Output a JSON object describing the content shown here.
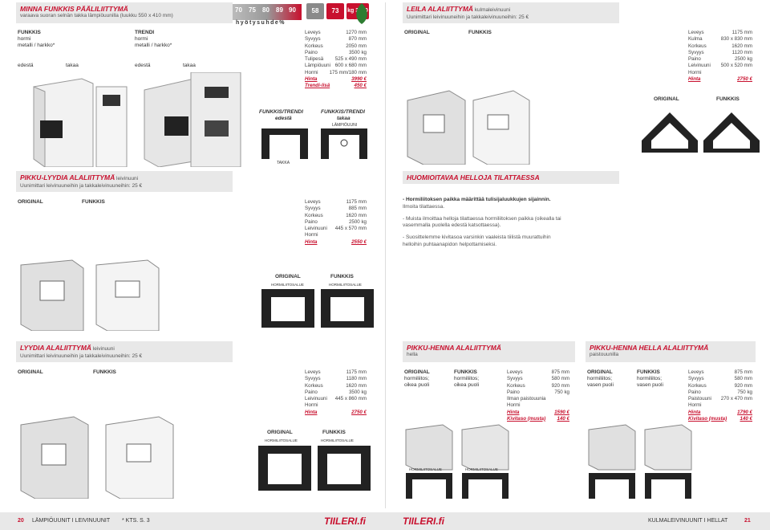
{
  "minna": {
    "title": "MINNA FUNKKIS PÄÄLILIITTYMÄ",
    "subtitle": "varaava suoran selnän takka lämpiöuunilla (luukku 550 x 410 mm)",
    "col1": "FUNKKIS",
    "col1a": "hormi",
    "col1b": "metalli / harkko*",
    "col2": "TRENDI",
    "col2a": "hormi",
    "col2b": "metalli / harkko*",
    "front1": "edestä",
    "back1": "takaa",
    "front2": "edestä",
    "back2": "takaa",
    "specs": [
      [
        "Leveys",
        "1270 mm"
      ],
      [
        "Syvyys",
        "870 mm"
      ],
      [
        "Korkeus",
        "2050 mm"
      ],
      [
        "Paino",
        "3500 kg"
      ],
      [
        "Tulipesä",
        "525 x 490 mm"
      ],
      [
        "Lämpiöuuni",
        "600 x 680 mm"
      ],
      [
        "Hormi",
        "175 mm/180 mm"
      ]
    ],
    "price_label": "Hinta",
    "price": "3990 €",
    "trendi_label": "Trendi-lisä",
    "trendi_price": "450 €",
    "diag1": "FUNKKIS/TRENDI",
    "diag1b": "edestä",
    "diag2": "FUNKKIS/TRENDI",
    "diag2b": "takaa",
    "lampio": "LÄMPIÖUUNI",
    "takka": "TAKKA",
    "dim": "380 mm"
  },
  "badges": [
    {
      "v": "58",
      "c": "#8a8a8a"
    },
    {
      "v": "73",
      "c": "#c8102e"
    },
    {
      "v": "kg 3500",
      "c": "#c8102e"
    }
  ],
  "effscale": {
    "values": [
      "70",
      "75",
      "80",
      "89",
      "90"
    ],
    "label": "hyötysuhde%"
  },
  "leila": {
    "title": "LEILA ALALIITTYMÄ",
    "tag": "kulmaleivinuuni",
    "subtitle": "Uunimittari leivinuuneihin ja takkaleivinuuneihin: 25 €",
    "orig": "ORIGINAL",
    "funk": "FUNKKIS",
    "specs": [
      [
        "Leveys",
        "1175 mm"
      ],
      [
        "Kulma",
        "830 x 830 mm"
      ],
      [
        "Korkeus",
        "1620 mm"
      ],
      [
        "Syvyys",
        "1120 mm"
      ],
      [
        "Paino",
        "2500 kg"
      ],
      [
        "Leivinuuni",
        "500 x 520 mm"
      ],
      [
        "Hormi",
        ""
      ]
    ],
    "price_label": "Hinta",
    "price": "2750 €",
    "d_orig": "ORIGINAL",
    "d_funk": "FUNKKIS",
    "dim": "330 mm"
  },
  "pikkulyydia": {
    "title": "PIKKU-LYYDIA ALALIITTYMÄ",
    "tag": "leivinuuni",
    "subtitle": "Uunimittari leivinuuneihin ja takkaleivinuuneihin: 25 €",
    "orig": "ORIGINAL",
    "funk": "FUNKKIS",
    "specs": [
      [
        "Leveys",
        "1175 mm"
      ],
      [
        "Syvyys",
        "885 mm"
      ],
      [
        "Korkeus",
        "1620 mm"
      ],
      [
        "Paino",
        "2500 kg"
      ],
      [
        "Leivinuuni",
        "445 x 570 mm"
      ],
      [
        "Hormi",
        ""
      ]
    ],
    "price_label": "Hinta",
    "price": "2550 €",
    "d_orig": "ORIGINAL",
    "d_funk": "FUNKKIS",
    "area": "HORMILIITOSALUE"
  },
  "helloja": {
    "title": "HUOMIOITAVAA HELLOJA TILATTAESSA",
    "n1b": "- Hormiliitoksen paikka määrittää tulisijaluukkujen sijainnin.",
    "n1": "Ilmoita tilattaessa.",
    "n2": "- Muista ilmoittaa helloja tilattaessa hormiliitoksen paikka (oikealla tai vasemmalla puolella edestä katsottaessa).",
    "n3": "- Suosittelemme kivitasoa varsinkin vaaleista tiilistä muurattuihin helloihin puhtaanapidon helpottamiseksi."
  },
  "lyydia": {
    "title": "LYYDIA ALALIITTYMÄ",
    "tag": "leivinuuni",
    "subtitle": "Uunimittari leivinuuneihin ja takkaleivinuuneihin: 25 €",
    "orig": "ORIGINAL",
    "funk": "FUNKKIS",
    "specs": [
      [
        "Leveys",
        "1175 mm"
      ],
      [
        "Syvyys",
        "1180 mm"
      ],
      [
        "Korkeus",
        "1620 mm"
      ],
      [
        "Paino",
        "3500 kg"
      ],
      [
        "Leivinuuni",
        "445 x 860 mm"
      ],
      [
        "Hormi",
        ""
      ]
    ],
    "price_label": "Hinta",
    "price": "2750 €",
    "d_orig": "ORIGINAL",
    "d_funk": "FUNKKIS",
    "area": "HORMILIITOSALUE"
  },
  "pikkuhenna": {
    "title": "PIKKU-HENNA ALALIITTYMÄ",
    "tag": "hella",
    "orig": "ORIGINAL",
    "origa": "hormiliitos;",
    "origb": "oikea puoli",
    "funk": "FUNKKIS",
    "funka": "hormiliitos;",
    "funkb": "oikea puoli",
    "specs": [
      [
        "Leveys",
        "875 mm"
      ],
      [
        "Syvyys",
        "580 mm"
      ],
      [
        "Korkeus",
        "920 mm"
      ],
      [
        "Paino",
        "750 kg"
      ],
      [
        "Ilman paistouunia",
        ""
      ],
      [
        "Hormi",
        ""
      ]
    ],
    "price_label": "Hinta",
    "price": "1590 €",
    "kivi_label": "Kivitaso (musta)",
    "kivi_price": "140 €",
    "area": "HORMILIITOSALUE"
  },
  "pikkuhennahella": {
    "title": "PIKKU-HENNA HELLA ALALIITTYMÄ",
    "tag": "paistouunilla",
    "orig": "ORIGINAL",
    "origa": "hormiliitos;",
    "origb": "vasen puoli",
    "funk": "FUNKKIS",
    "funka": "hormiliitos;",
    "funkb": "vasen puoli",
    "specs": [
      [
        "Leveys",
        "875 mm"
      ],
      [
        "Syvyys",
        "580 mm"
      ],
      [
        "Korkeus",
        "920 mm"
      ],
      [
        "Paino",
        "750 kg"
      ],
      [
        "Paistouuni",
        "270 x 470 mm"
      ],
      [
        "Hormi",
        ""
      ]
    ],
    "price_label": "Hinta",
    "price": "1790 €",
    "kivi_label": "Kivitaso (musta)",
    "kivi_price": "140 €"
  },
  "footer": {
    "left_num": "20",
    "left_text": "LÄMPIÖUUNIT I LEIVINUUNIT",
    "left_ref": "* KTS. S. 3",
    "logo": "TIILERI.fi",
    "right_text": "KULMALEIVINUUNIT I HELLAT",
    "right_num": "21"
  }
}
